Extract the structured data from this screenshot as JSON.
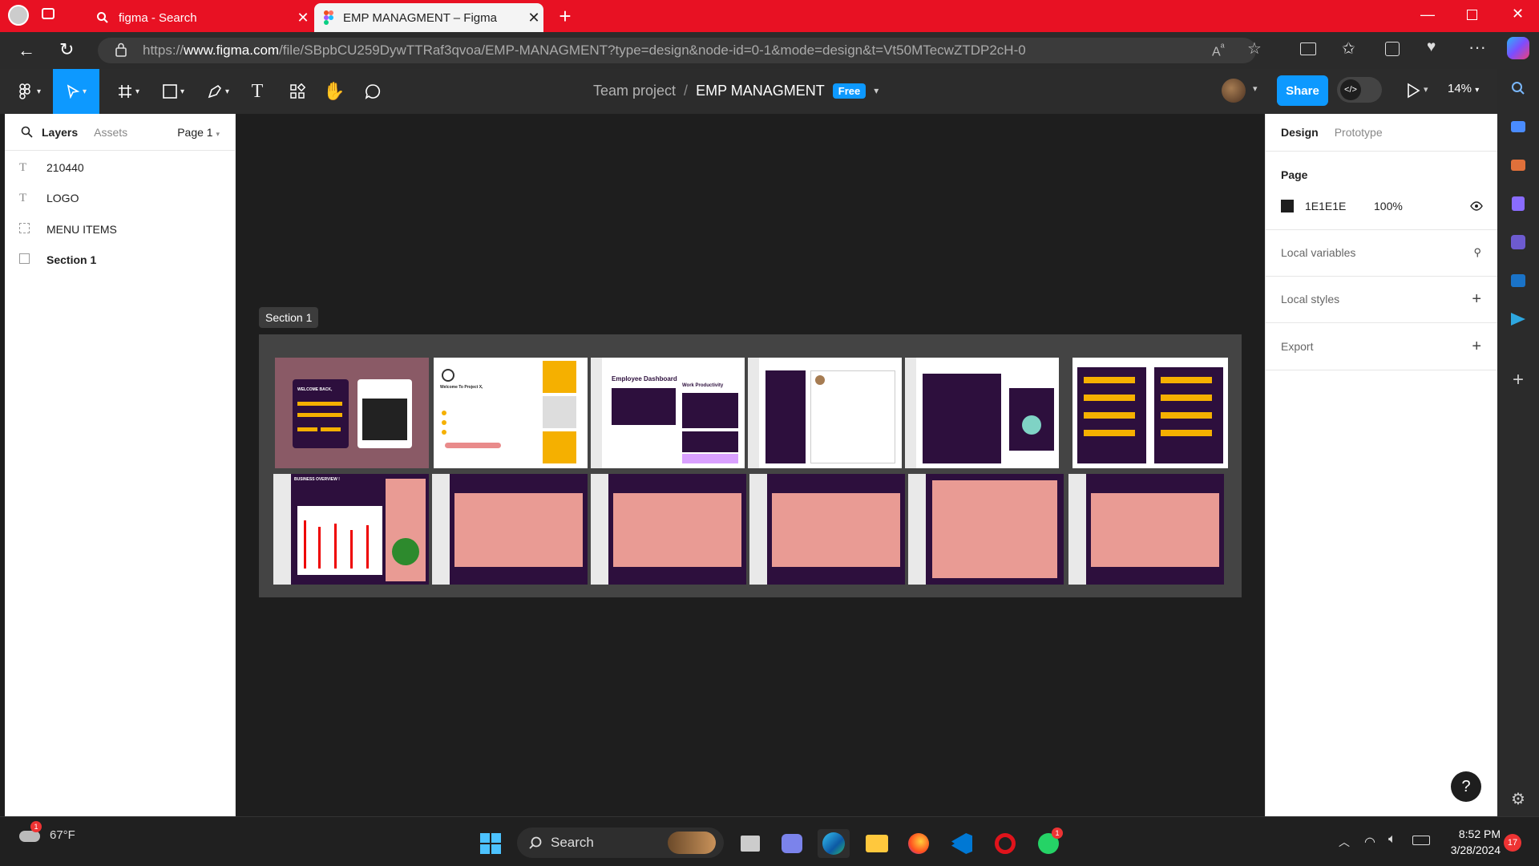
{
  "browser": {
    "tabs": [
      {
        "label": "figma - Search",
        "active": false
      },
      {
        "label": "EMP MANAGMENT – Figma",
        "active": true
      }
    ],
    "url_prefix": "https://",
    "url_host": "www.figma.com",
    "url_rest": "/file/SBpbCU259DywTTRaf3qvoa/EMP-MANAGMENT?type=design&node-id=0-1&mode=design&t=Vt50MTecwZTDP2cH-0",
    "accent": "#e81123"
  },
  "figma": {
    "breadcrumb": {
      "team": "Team project",
      "separator": "/",
      "file": "EMP MANAGMENT",
      "badge": "Free"
    },
    "share_label": "Share",
    "zoom": "14%",
    "accent": "#0d99ff",
    "left_panel": {
      "tabs": [
        "Layers",
        "Assets"
      ],
      "page_selector": "Page 1",
      "layers": [
        {
          "name": "210440",
          "icon": "text-icon"
        },
        {
          "name": "LOGO",
          "icon": "text-icon"
        },
        {
          "name": "MENU ITEMS",
          "icon": "dashed-frame-icon"
        },
        {
          "name": "Section 1",
          "icon": "section-icon"
        }
      ]
    },
    "canvas": {
      "section_label": "Section 1",
      "frame_texts": {
        "dashboard_title": "Employee Dashboard",
        "work_productivity": "Work Productivity",
        "welcome": "WELCOME BACK,",
        "project": "Welcome To Project X,",
        "business_overview": "BUSINESS OVERVIEW !"
      }
    },
    "right_panel": {
      "tabs": [
        "Design",
        "Prototype"
      ],
      "page_heading": "Page",
      "page_color": "1E1E1E",
      "page_opacity": "100%",
      "sections": [
        "Local variables",
        "Local styles",
        "Export"
      ]
    }
  },
  "taskbar": {
    "weather": "67°F",
    "search_label": "Search",
    "time": "8:52 PM",
    "date": "3/28/2024",
    "notification_count": "17"
  }
}
